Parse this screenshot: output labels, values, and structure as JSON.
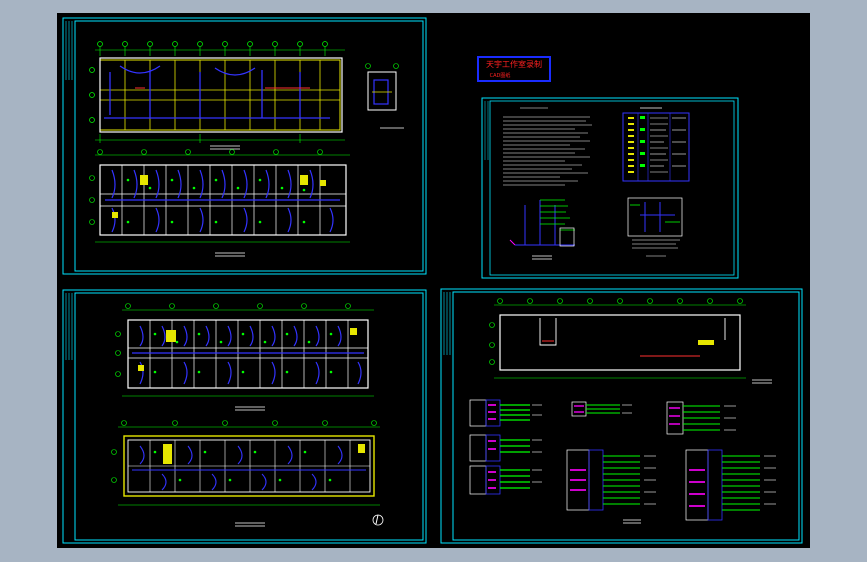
{
  "viewport": {
    "background": "#a7b4c3",
    "model_space": "#000000"
  },
  "colors": {
    "frame": "#00ffff",
    "wall": "#ffffff",
    "wire": "#3333ff",
    "grid": "#00ff00",
    "fixture": "#ffff00",
    "device": "#ff00ff",
    "stamp_border": "#1a2cff",
    "stamp_text": "#ff2020"
  },
  "sheets": [
    {
      "id": "sheet-1",
      "content": "lighting-plans-upper"
    },
    {
      "id": "sheet-2",
      "content": "design-notes-and-legend"
    },
    {
      "id": "sheet-3",
      "content": "lighting-plans-lower"
    },
    {
      "id": "sheet-4",
      "content": "roof-plan-and-panel-schedules"
    }
  ],
  "stamp": {
    "line1": "天宇工作室录制",
    "line2": "CAD图纸"
  }
}
